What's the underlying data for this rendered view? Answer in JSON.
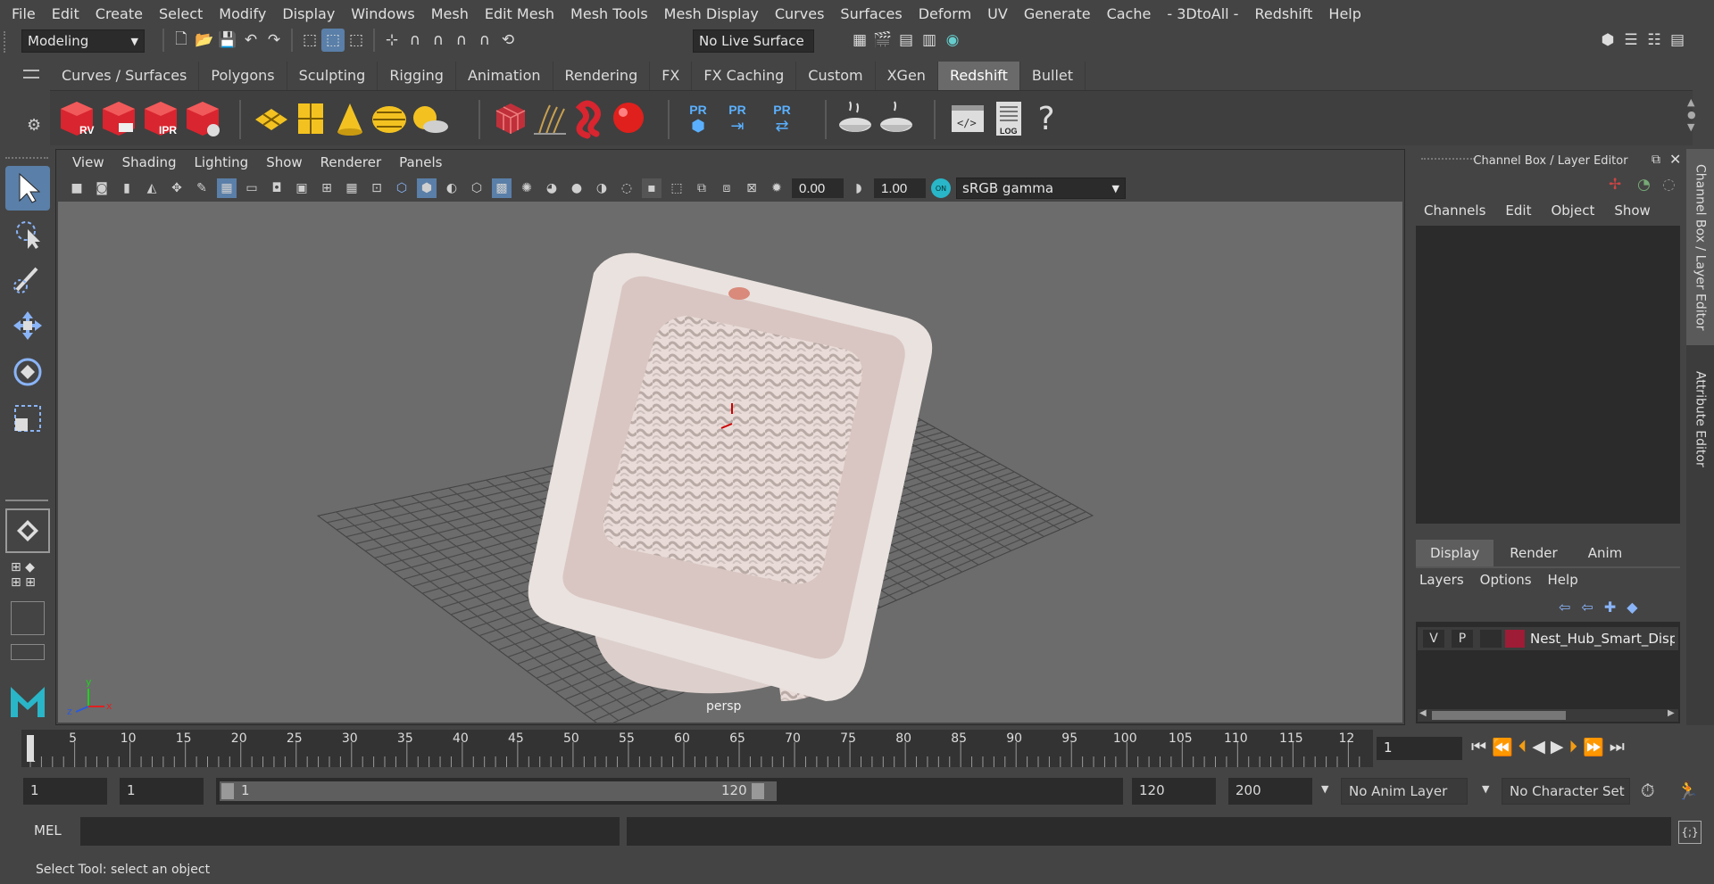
{
  "menubar": [
    "File",
    "Edit",
    "Create",
    "Select",
    "Modify",
    "Display",
    "Windows",
    "Mesh",
    "Edit Mesh",
    "Mesh Tools",
    "Mesh Display",
    "Curves",
    "Surfaces",
    "Deform",
    "UV",
    "Generate",
    "Cache",
    "- 3DtoAll -",
    "Redshift",
    "Help"
  ],
  "toolbar": {
    "mode": "Modeling",
    "live_surface": "No Live Surface"
  },
  "shelf_tabs": [
    "Curves / Surfaces",
    "Polygons",
    "Sculpting",
    "Rigging",
    "Animation",
    "Rendering",
    "FX",
    "FX Caching",
    "Custom",
    "XGen",
    "Redshift",
    "Bullet"
  ],
  "shelf_active": "Redshift",
  "shelf_icons": {
    "rv": "RV",
    "ipr": "IPR",
    "pr": "PR",
    "log": "LOG"
  },
  "viewport": {
    "menu": [
      "View",
      "Shading",
      "Lighting",
      "Show",
      "Renderer",
      "Panels"
    ],
    "exposure": "0.00",
    "gamma": "1.00",
    "color_space": "sRGB gamma",
    "camera_label": "persp"
  },
  "channel_box": {
    "title": "Channel Box / Layer Editor",
    "menu": [
      "Channels",
      "Edit",
      "Object",
      "Show"
    ]
  },
  "layer_editor": {
    "tabs": [
      "Display",
      "Render",
      "Anim"
    ],
    "menu": [
      "Layers",
      "Options",
      "Help"
    ],
    "layer": {
      "v": "V",
      "p": "P",
      "name": "Nest_Hub_Smart_Displ",
      "color": "#9e1c36"
    }
  },
  "side_tabs": [
    "Channel Box / Layer Editor",
    "Attribute Editor"
  ],
  "timeline": {
    "ticks": [
      "1",
      "5",
      "10",
      "15",
      "20",
      "25",
      "30",
      "35",
      "40",
      "45",
      "50",
      "55",
      "60",
      "65",
      "70",
      "75",
      "80",
      "85",
      "90",
      "95",
      "100",
      "105",
      "110",
      "115",
      "12"
    ],
    "current_frame": "1"
  },
  "range": {
    "start": "1",
    "anim_start": "1",
    "slider_start": "1",
    "slider_end": "120",
    "end": "120",
    "anim_end": "200",
    "anim_layer": "No Anim Layer",
    "char_set": "No Character Set"
  },
  "mel": {
    "label": "MEL"
  },
  "help_line": "Select Tool: select an object",
  "colors": {
    "accent_blue": "#5a8fc8",
    "redshift_red": "#d8252f",
    "yellow": "#f3c221"
  }
}
